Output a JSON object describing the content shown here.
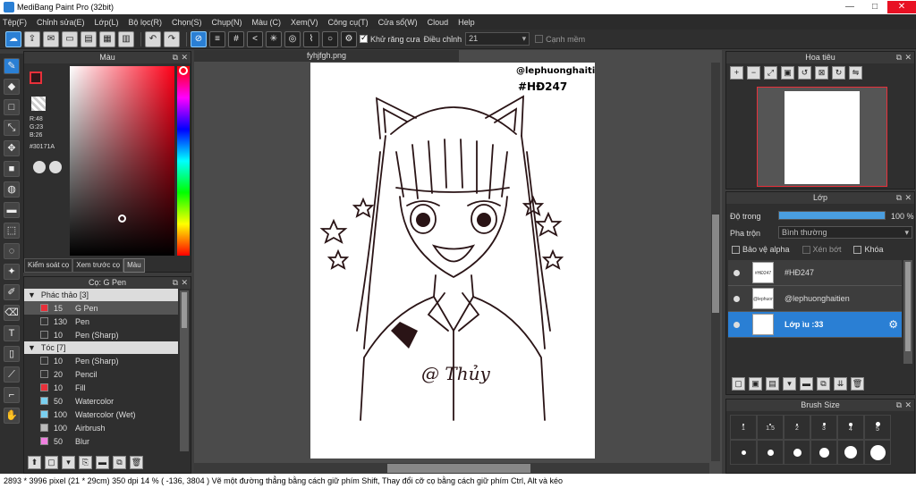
{
  "window": {
    "title": "MediBang Paint Pro (32bit)"
  },
  "menu": [
    "Tệp(F)",
    "Chỉnh sửa(E)",
    "Lớp(L)",
    "Bộ lọc(R)",
    "Chọn(S)",
    "Chụp(N)",
    "Màu (C)",
    "Xem(V)",
    "Công cụ(T)",
    "Cửa sổ(W)",
    "Cloud",
    "Help"
  ],
  "toolbar": {
    "antialias_label": "Khử răng cưa",
    "correction_label": "Điều chỉnh",
    "correction_value": "21",
    "edge_label": "Cạnh mềm"
  },
  "color_panel": {
    "title": "Màu",
    "r": "R:48",
    "g": "G:23",
    "b": "B:26",
    "hex": "#30171A",
    "fg_color": "#30171A",
    "tabs": [
      "Kiểm soát cọ",
      "Xem trước cọ",
      "Màu"
    ]
  },
  "brush_panel": {
    "title": "Cọ: G Pen",
    "groups": [
      {
        "name": "Phác thảo [3]",
        "items": [
          {
            "size": "15",
            "name": "G Pen",
            "color": "#e8303a"
          },
          {
            "size": "130",
            "name": "Pen",
            "color": "#333333"
          },
          {
            "size": "10",
            "name": "Pen (Sharp)",
            "color": "#333333"
          }
        ]
      },
      {
        "name": "Tóc [7]",
        "items": [
          {
            "size": "10",
            "name": "Pen (Sharp)",
            "color": "#333333"
          },
          {
            "size": "20",
            "name": "Pencil",
            "color": "#333333"
          },
          {
            "size": "10",
            "name": "Fill",
            "color": "#e8303a"
          },
          {
            "size": "50",
            "name": "Watercolor",
            "color": "#7ad0f0"
          },
          {
            "size": "100",
            "name": "Watercolor (Wet)",
            "color": "#7ad0f0"
          },
          {
            "size": "100",
            "name": "Airbrush",
            "color": "#bbbbbb"
          },
          {
            "size": "50",
            "name": "Blur",
            "color": "#f080e0"
          }
        ]
      }
    ]
  },
  "canvas": {
    "tab": "fyhjfgh.png",
    "watermark_line1": "@lephuonghaitien",
    "watermark_line2": "#HĐ247",
    "signature": "@ Thủy"
  },
  "navigator": {
    "title": "Hoa tiêu"
  },
  "layer_panel": {
    "title": "Lớp",
    "opacity_label": "Độ trong",
    "opacity_value": "100 %",
    "opacity": 1.0,
    "blend_label": "Pha trộn",
    "blend_value": "Bình thường",
    "protect_alpha": "Bảo vệ alpha",
    "clipping": "Xén bớt",
    "lock": "Khóa",
    "layers": [
      {
        "name": "#HĐ247",
        "thumb": "#HĐ247",
        "selected": false
      },
      {
        "name": "@lephuonghaitien",
        "thumb": "@lephuong",
        "selected": false
      },
      {
        "name": "Lớp ìu :33",
        "thumb": "",
        "selected": true
      }
    ]
  },
  "brush_size_panel": {
    "title": "Brush Size",
    "sizes": [
      "1",
      "1.5",
      "2",
      "3",
      "4",
      "5",
      "",
      "",
      "",
      "",
      "",
      ""
    ]
  },
  "status": {
    "text": "2893 * 3996 pixel   (21 * 29cm)   350 dpi   14 %   ( -136, 3804 )   Vẽ một đường thẳng bằng cách giữ phím Shift, Thay đổi cỡ cọ bằng cách giữ phím Ctrl, Alt và kéo"
  }
}
